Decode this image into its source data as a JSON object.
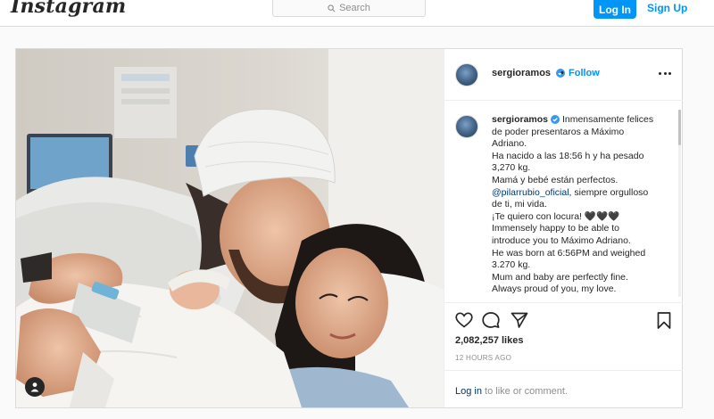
{
  "header": {
    "logo_text": "Instagram",
    "search_placeholder": "Search",
    "login_label": "Log In",
    "signup_label": "Sign Up"
  },
  "post": {
    "username": "sergioramos",
    "separator": "•",
    "follow_label": "Follow",
    "caption_lines": [
      "Inmensamente felices",
      "de poder presentaros a Máximo",
      "Adriano.",
      "Ha nacido a las 18:56 h y ha pesado",
      "3,270 kg.",
      "Mamá y bebé están perfectos.",
      "@pilarrubio_oficial",
      ", siempre orgulloso",
      "de ti, mi vida.",
      "¡Te quiero con locura! 🖤🖤🖤",
      "Immensely happy to be able to",
      "introduce you to Máximo Adriano.",
      "He was born at 6:56PM and weighed",
      "3.270 kg.",
      "Mum and baby are perfectly fine.",
      "Always proud of you, my love."
    ],
    "likes": "2,082,257 likes",
    "time_ago": "12 HOURS AGO",
    "login_link": "Log in",
    "login_suffix": " to like or comment."
  },
  "colors": {
    "accent": "#0095f6",
    "text": "#262626",
    "muted": "#8e8e8e",
    "mention": "#00376b"
  },
  "icons": [
    "search-icon",
    "verified-badge-icon",
    "more-options-icon",
    "heart-icon",
    "comment-icon",
    "share-icon",
    "bookmark-icon",
    "user-tag-icon"
  ]
}
